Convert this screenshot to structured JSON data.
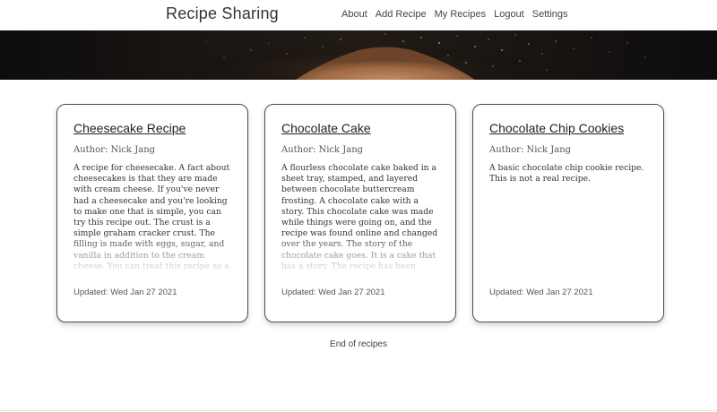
{
  "brand": "Recipe Sharing",
  "nav": [
    "About",
    "Add Recipe",
    "My Recipes",
    "Logout",
    "Settings"
  ],
  "recipes": [
    {
      "title": "Cheesecake Recipe",
      "author": "Author: Nick Jang",
      "description": "A recipe for cheesecake. A fact about cheesecakes is that they are made with cream cheese. If you've never had a cheesecake and you're looking to make one that is simple, you can try this recipe out. The crust is a simple graham cracker crust. The filling is made with eggs, sugar, and vanilla in addition to the cream cheese. You can treat this recipe as a blank canvas for fillings that",
      "updated": "Updated: Wed Jan 27 2021"
    },
    {
      "title": "Chocolate Cake",
      "author": "Author: Nick Jang",
      "description": "A flourless chocolate cake baked in a sheet tray, stamped, and layered between chocolate buttercream frosting. A chocolate cake with a story. This chocolate cake was made while things were going on, and the recipe was found online and changed over the years. The story of the chocolate cake goes. It is a cake that has a story. The recipe has been around for many years, but it was",
      "updated": "Updated: Wed Jan 27 2021"
    },
    {
      "title": "Chocolate Chip Cookies",
      "author": "Author: Nick Jang",
      "description": "A basic chocolate chip cookie recipe. This is not a real recipe.",
      "updated": "Updated: Wed Jan 27 2021"
    }
  ],
  "end_text": "End of recipes",
  "colors": {
    "card_border": "#5a4a42",
    "hero_dark": "#0d0c0c",
    "powder": "#b27a52"
  }
}
